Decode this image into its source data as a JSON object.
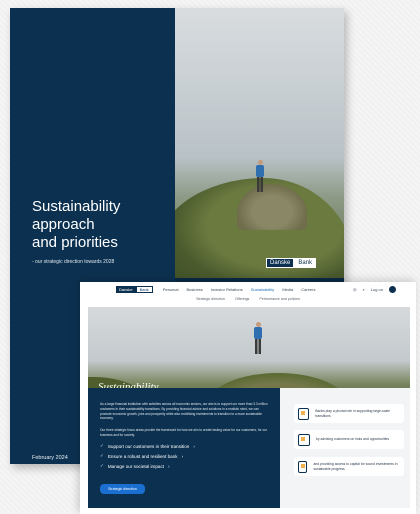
{
  "cover": {
    "title_lines": [
      "Sustainability",
      "approach",
      "and priorities"
    ],
    "subtitle": "- our strategic direction towards 2028",
    "date": "February 2024",
    "logo": {
      "a": "Danske",
      "b": "Bank"
    }
  },
  "site": {
    "brand": {
      "a": "Danske",
      "b": "Bank"
    },
    "nav": [
      "Personal",
      "Business",
      "Investor Relations",
      "Sustainability",
      "Media",
      "Careers"
    ],
    "nav_active_index": 3,
    "right": {
      "login": "Log on"
    },
    "subnav": [
      "Strategic direction",
      "Offerings",
      "Performance and policies"
    ],
    "hero_title": "Sustainability",
    "intro_text": "As a large financial institution with activities across all economic sectors, our aim is to support our more than 3.3 million customers in their sustainability transitions. By providing financial advice and solutions in a realistic mind, we can promote economic growth, jobs and prosperity while also mobilising investments to transition to a more sustainable economy.",
    "intro_text2": "Our three strategic focus areas provide the framework for how we aim to create lasting value for our customers, for our business and for society.",
    "checks": [
      "Support our customers in their transition",
      "Ensure a robust and resilient bank",
      "Manage our societal impact"
    ],
    "cta": "Strategic direction",
    "cards": [
      "Banks play a pivotal role in supporting large-scale transitions",
      "by advising customers on risks and opportunities",
      "and providing access to capital for sound investments in sustainable progress"
    ]
  }
}
